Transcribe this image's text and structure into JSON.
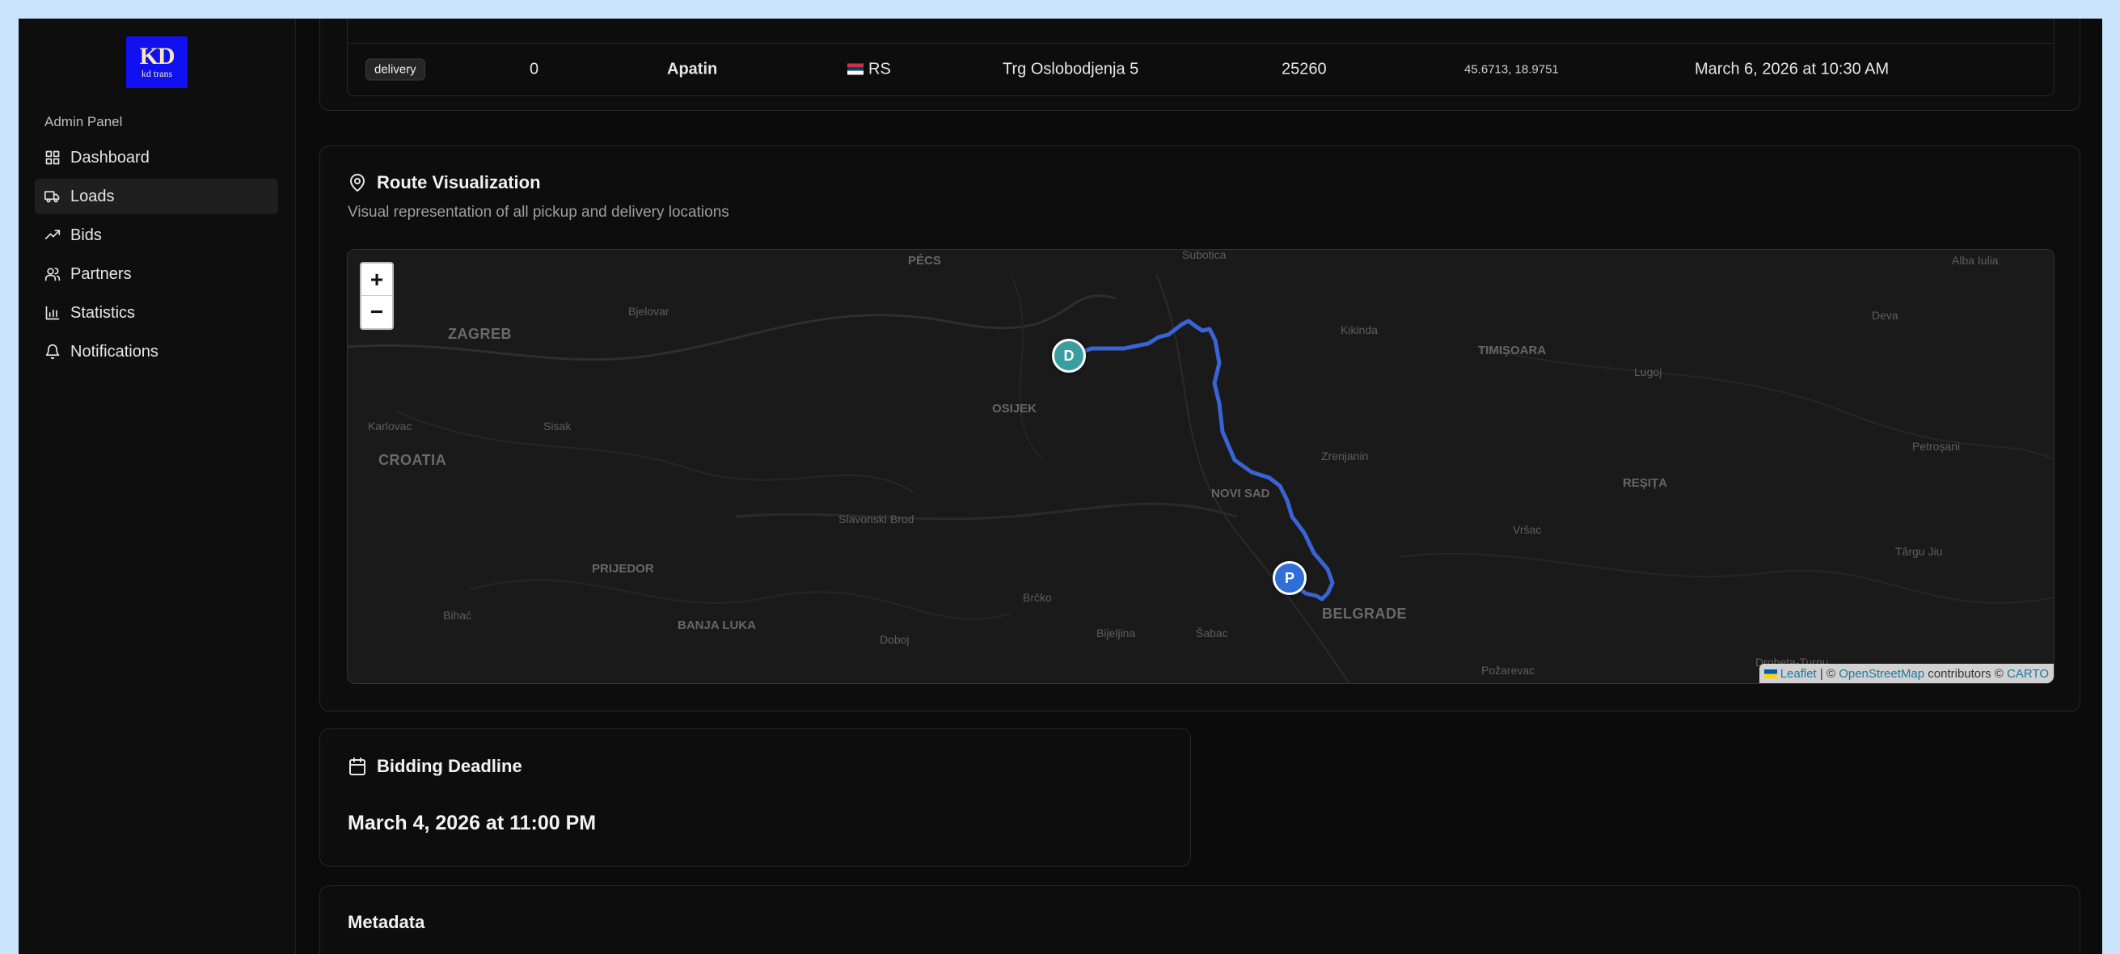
{
  "sidebar": {
    "logo": {
      "main": "KD",
      "sub": "kd trans"
    },
    "panel_label": "Admin Panel",
    "items": [
      {
        "label": "Dashboard",
        "icon": "grid-icon",
        "active": false
      },
      {
        "label": "Loads",
        "icon": "truck-icon",
        "active": true
      },
      {
        "label": "Bids",
        "icon": "trending-up-icon",
        "active": false
      },
      {
        "label": "Partners",
        "icon": "users-icon",
        "active": false
      },
      {
        "label": "Statistics",
        "icon": "bar-chart-icon",
        "active": false
      },
      {
        "label": "Notifications",
        "icon": "bell-icon",
        "active": false
      }
    ]
  },
  "stops_table": {
    "row": {
      "type": "delivery",
      "sequence": "0",
      "city": "Apatin",
      "country": "RS",
      "address": "Trg Oslobodjenja 5",
      "postal_code": "25260",
      "coordinates": "45.6713, 18.9751",
      "datetime": "March 6, 2026 at 10:30 AM"
    }
  },
  "route": {
    "title": "Route Visualization",
    "subtitle": "Visual representation of all pickup and delivery locations",
    "zoom_in": "+",
    "zoom_out": "−",
    "markers": {
      "delivery": "D",
      "pickup": "P"
    },
    "route_color": "#3a63d6",
    "delivery_color": "#3a9ea0",
    "pickup_color": "#2f6fd6",
    "labels": {
      "pecs": "PÉCS",
      "subotica": "Subotica",
      "alba_iulia": "Alba Iulia",
      "zagreb": "ZAGREB",
      "bjelovar": "Bjelovar",
      "kikinda": "Kikinda",
      "timisoara": "TIMIȘOARA",
      "lugoj": "Lugoj",
      "deva": "Deva",
      "osijek": "OSIJEK",
      "karlovac": "Karlovac",
      "sisak": "Sisak",
      "croatia": "CROATIA",
      "zrenjanin": "Zrenjanin",
      "petrosani": "Petroșani",
      "novi_sad": "NOVI SAD",
      "resita": "REȘIȚA",
      "slavonski_brod": "Slavonski Brod",
      "vrsac": "Vršac",
      "targu_jiu": "Târgu Jiu",
      "prijedor": "PRIJEDOR",
      "brcko": "Brčko",
      "bihac": "Bihać",
      "banja_luka": "BANJA LUKA",
      "belgrade": "BELGRADE",
      "doboj": "Doboj",
      "bijeljina": "Bijeljina",
      "sabac": "Šabac",
      "pozarevac": "Požarevac",
      "drobeta": "Drobeta-Turnu"
    },
    "attribution": {
      "leaflet": "Leaflet",
      "sep": " | © ",
      "osm": "OpenStreetMap",
      "contrib": " contributors © ",
      "carto": "CARTO"
    }
  },
  "deadline": {
    "title": "Bidding Deadline",
    "value": "March 4, 2026 at 11:00 PM"
  },
  "metadata": {
    "title": "Metadata"
  }
}
